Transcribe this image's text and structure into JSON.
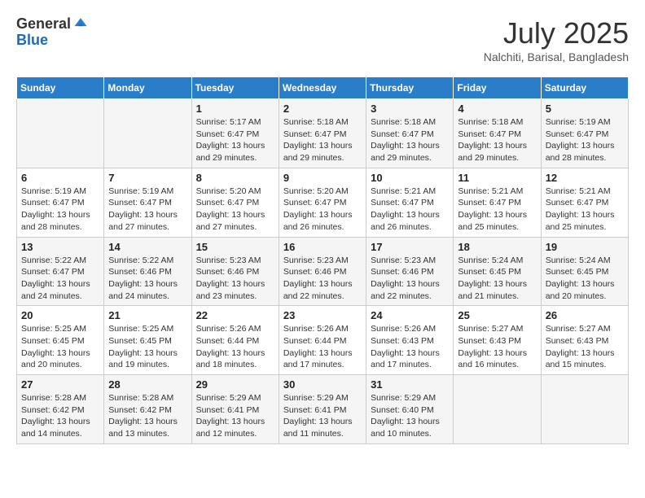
{
  "header": {
    "logo_general": "General",
    "logo_blue": "Blue",
    "title": "July 2025",
    "location": "Nalchiti, Barisal, Bangladesh"
  },
  "calendar": {
    "days_of_week": [
      "Sunday",
      "Monday",
      "Tuesday",
      "Wednesday",
      "Thursday",
      "Friday",
      "Saturday"
    ],
    "weeks": [
      [
        {
          "day": "",
          "info": ""
        },
        {
          "day": "",
          "info": ""
        },
        {
          "day": "1",
          "info": "Sunrise: 5:17 AM\nSunset: 6:47 PM\nDaylight: 13 hours and 29 minutes."
        },
        {
          "day": "2",
          "info": "Sunrise: 5:18 AM\nSunset: 6:47 PM\nDaylight: 13 hours and 29 minutes."
        },
        {
          "day": "3",
          "info": "Sunrise: 5:18 AM\nSunset: 6:47 PM\nDaylight: 13 hours and 29 minutes."
        },
        {
          "day": "4",
          "info": "Sunrise: 5:18 AM\nSunset: 6:47 PM\nDaylight: 13 hours and 29 minutes."
        },
        {
          "day": "5",
          "info": "Sunrise: 5:19 AM\nSunset: 6:47 PM\nDaylight: 13 hours and 28 minutes."
        }
      ],
      [
        {
          "day": "6",
          "info": "Sunrise: 5:19 AM\nSunset: 6:47 PM\nDaylight: 13 hours and 28 minutes."
        },
        {
          "day": "7",
          "info": "Sunrise: 5:19 AM\nSunset: 6:47 PM\nDaylight: 13 hours and 27 minutes."
        },
        {
          "day": "8",
          "info": "Sunrise: 5:20 AM\nSunset: 6:47 PM\nDaylight: 13 hours and 27 minutes."
        },
        {
          "day": "9",
          "info": "Sunrise: 5:20 AM\nSunset: 6:47 PM\nDaylight: 13 hours and 26 minutes."
        },
        {
          "day": "10",
          "info": "Sunrise: 5:21 AM\nSunset: 6:47 PM\nDaylight: 13 hours and 26 minutes."
        },
        {
          "day": "11",
          "info": "Sunrise: 5:21 AM\nSunset: 6:47 PM\nDaylight: 13 hours and 25 minutes."
        },
        {
          "day": "12",
          "info": "Sunrise: 5:21 AM\nSunset: 6:47 PM\nDaylight: 13 hours and 25 minutes."
        }
      ],
      [
        {
          "day": "13",
          "info": "Sunrise: 5:22 AM\nSunset: 6:47 PM\nDaylight: 13 hours and 24 minutes."
        },
        {
          "day": "14",
          "info": "Sunrise: 5:22 AM\nSunset: 6:46 PM\nDaylight: 13 hours and 24 minutes."
        },
        {
          "day": "15",
          "info": "Sunrise: 5:23 AM\nSunset: 6:46 PM\nDaylight: 13 hours and 23 minutes."
        },
        {
          "day": "16",
          "info": "Sunrise: 5:23 AM\nSunset: 6:46 PM\nDaylight: 13 hours and 22 minutes."
        },
        {
          "day": "17",
          "info": "Sunrise: 5:23 AM\nSunset: 6:46 PM\nDaylight: 13 hours and 22 minutes."
        },
        {
          "day": "18",
          "info": "Sunrise: 5:24 AM\nSunset: 6:45 PM\nDaylight: 13 hours and 21 minutes."
        },
        {
          "day": "19",
          "info": "Sunrise: 5:24 AM\nSunset: 6:45 PM\nDaylight: 13 hours and 20 minutes."
        }
      ],
      [
        {
          "day": "20",
          "info": "Sunrise: 5:25 AM\nSunset: 6:45 PM\nDaylight: 13 hours and 20 minutes."
        },
        {
          "day": "21",
          "info": "Sunrise: 5:25 AM\nSunset: 6:45 PM\nDaylight: 13 hours and 19 minutes."
        },
        {
          "day": "22",
          "info": "Sunrise: 5:26 AM\nSunset: 6:44 PM\nDaylight: 13 hours and 18 minutes."
        },
        {
          "day": "23",
          "info": "Sunrise: 5:26 AM\nSunset: 6:44 PM\nDaylight: 13 hours and 17 minutes."
        },
        {
          "day": "24",
          "info": "Sunrise: 5:26 AM\nSunset: 6:43 PM\nDaylight: 13 hours and 17 minutes."
        },
        {
          "day": "25",
          "info": "Sunrise: 5:27 AM\nSunset: 6:43 PM\nDaylight: 13 hours and 16 minutes."
        },
        {
          "day": "26",
          "info": "Sunrise: 5:27 AM\nSunset: 6:43 PM\nDaylight: 13 hours and 15 minutes."
        }
      ],
      [
        {
          "day": "27",
          "info": "Sunrise: 5:28 AM\nSunset: 6:42 PM\nDaylight: 13 hours and 14 minutes."
        },
        {
          "day": "28",
          "info": "Sunrise: 5:28 AM\nSunset: 6:42 PM\nDaylight: 13 hours and 13 minutes."
        },
        {
          "day": "29",
          "info": "Sunrise: 5:29 AM\nSunset: 6:41 PM\nDaylight: 13 hours and 12 minutes."
        },
        {
          "day": "30",
          "info": "Sunrise: 5:29 AM\nSunset: 6:41 PM\nDaylight: 13 hours and 11 minutes."
        },
        {
          "day": "31",
          "info": "Sunrise: 5:29 AM\nSunset: 6:40 PM\nDaylight: 13 hours and 10 minutes."
        },
        {
          "day": "",
          "info": ""
        },
        {
          "day": "",
          "info": ""
        }
      ]
    ]
  }
}
